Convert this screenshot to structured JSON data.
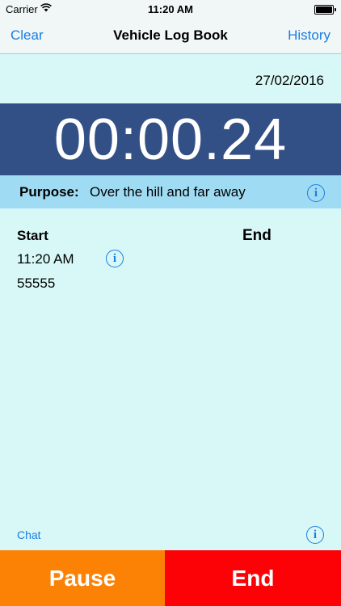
{
  "status_bar": {
    "carrier": "Carrier",
    "time": "11:20 AM"
  },
  "nav": {
    "left": "Clear",
    "title": "Vehicle Log Book",
    "right": "History"
  },
  "date": "27/02/2016",
  "timer": "00:00.24",
  "purpose": {
    "label": "Purpose:",
    "value": "Over the hill and far away",
    "info_icon": "i"
  },
  "trip": {
    "start_label": "Start",
    "end_label": "End",
    "start_time": "11:20 AM",
    "odometer": "55555",
    "info_icon": "i"
  },
  "footer": {
    "chat": "Chat",
    "info_icon": "i"
  },
  "actions": {
    "pause": "Pause",
    "end": "End"
  },
  "colors": {
    "accent": "#1a7ee0",
    "timer_bg": "#324f86",
    "purpose_bg": "#9fdcf4",
    "pause_bg": "#fc8205",
    "end_bg": "#fc0207"
  }
}
